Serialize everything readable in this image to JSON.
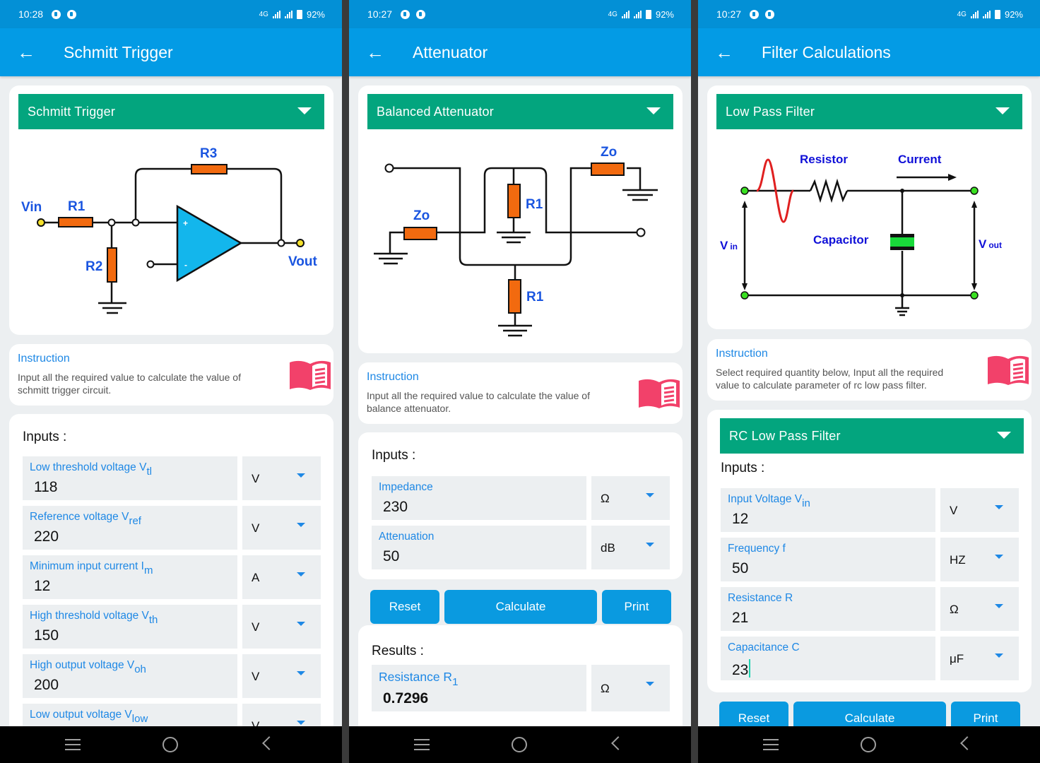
{
  "status_bar": {
    "network": "4G",
    "battery": "92%"
  },
  "screens": [
    {
      "time": "10:28",
      "title": "Schmitt Trigger",
      "selector": "Schmitt Trigger",
      "diagram_labels": {
        "vin": "Vin",
        "r1": "R1",
        "r2": "R2",
        "r3": "R3",
        "vout": "Vout",
        "plus": "+",
        "minus": "-"
      },
      "instruction": {
        "heading": "Instruction",
        "text": "Input all the required value to calculate the value of schmitt trigger circuit."
      },
      "inputs_label": "Inputs :",
      "inputs": [
        {
          "label": "Low threshold voltage V",
          "sub": "tl",
          "value": "118",
          "unit": "V"
        },
        {
          "label": "Reference voltage V",
          "sub": "ref",
          "value": "220",
          "unit": "V"
        },
        {
          "label": "Minimum input current I",
          "sub": "m",
          "value": "12",
          "unit": "A"
        },
        {
          "label": "High threshold voltage V",
          "sub": "th",
          "value": "150",
          "unit": "V"
        },
        {
          "label": "High output voltage V",
          "sub": "oh",
          "value": "200",
          "unit": "V"
        },
        {
          "label": "Low output voltage V",
          "sub": "low",
          "value": "",
          "unit": "V"
        }
      ]
    },
    {
      "time": "10:27",
      "title": "Attenuator",
      "selector": "Balanced Attenuator",
      "diagram_labels": {
        "zo_left": "Zo",
        "zo_right": "Zo",
        "r1_top": "R1",
        "r1_bottom": "R1"
      },
      "instruction": {
        "heading": "Instruction",
        "text": "Input all the required value to calculate the value of balance attenuator."
      },
      "inputs_label": "Inputs :",
      "inputs": [
        {
          "label": "Impedance",
          "sub": "",
          "value": "230",
          "unit": "Ω"
        },
        {
          "label": "Attenuation",
          "sub": "",
          "value": "50",
          "unit": "dB"
        }
      ],
      "buttons": {
        "reset": "Reset",
        "calculate": "Calculate",
        "print": "Print"
      },
      "results_label": "Results :",
      "results": [
        {
          "label": "Resistance R",
          "sub": "1",
          "value": "0.7296",
          "unit": "Ω"
        }
      ]
    },
    {
      "time": "10:27",
      "title": "Filter Calculations",
      "selector": "Low Pass Filter",
      "diagram_labels": {
        "resistor": "Resistor",
        "current": "Current",
        "capacitor": "Capacitor",
        "vin": "V",
        "vin_sub": "in",
        "vout": "V",
        "vout_sub": "out"
      },
      "instruction": {
        "heading": "Instruction",
        "text": "Select required quantity below, Input all the required value to calculate parameter of rc low pass filter."
      },
      "sub_selector": "RC Low Pass Filter",
      "inputs_label": "Inputs :",
      "inputs": [
        {
          "label": "Input Voltage V",
          "sub": "in",
          "value": "12",
          "unit": "V"
        },
        {
          "label": "Frequency f",
          "sub": "",
          "value": "50",
          "unit": "HZ"
        },
        {
          "label": "Resistance R",
          "sub": "",
          "value": "21",
          "unit": "Ω"
        },
        {
          "label": "Capacitance C",
          "sub": "",
          "value": "23",
          "unit": "μF"
        }
      ],
      "buttons": {
        "reset": "Reset",
        "calculate": "Calculate",
        "print": "Print"
      }
    }
  ],
  "colors": {
    "status_bar": "#0390d6",
    "app_bar": "#039be5",
    "selector_green": "#03a57e",
    "label_blue": "#1e88e5",
    "button_blue": "#0a9ae0",
    "resistor_orange": "#f26a0f",
    "opamp_cyan": "#13b6ec",
    "book_red": "#f2416a"
  }
}
